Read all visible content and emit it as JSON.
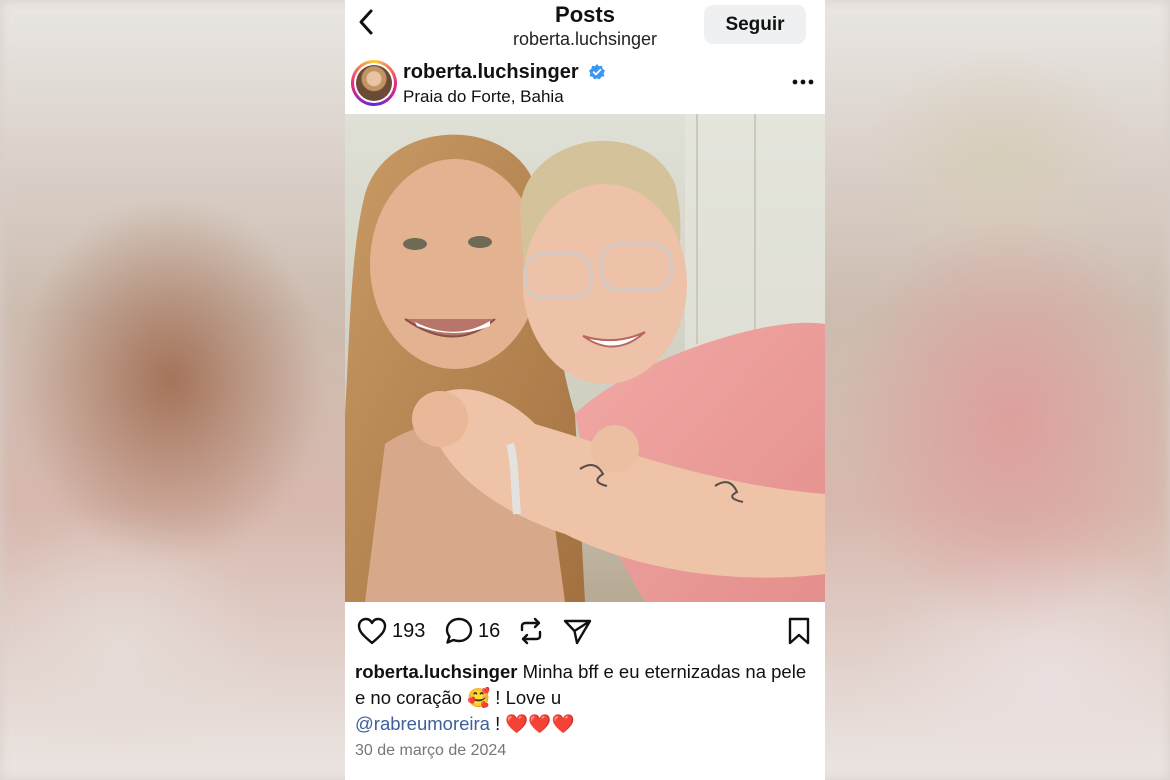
{
  "header": {
    "title": "Posts",
    "subtitle": "roberta.luchsinger",
    "follow_label": "Seguir"
  },
  "post": {
    "username": "roberta.luchsinger",
    "verified": true,
    "location": "Praia do Forte, Bahia",
    "likes": "193",
    "comments": "16",
    "caption_user": "roberta.luchsinger",
    "caption_text": "Minha bff e eu eternizadas na pele e no coração",
    "caption_emoji": "🥰",
    "caption_after": "! Love u",
    "mention": "@rabreumoreira",
    "caption_end": "!",
    "hearts": "❤️❤️❤️",
    "date": "30 de março de 2024"
  },
  "colors": {
    "verified_badge": "#3897f0",
    "mention": "#3e5e9c",
    "follow_button_bg": "#eef0f2",
    "heart": "#e0245e"
  },
  "icons": [
    "back-icon",
    "verified-icon",
    "more-icon",
    "like-icon",
    "comment-icon",
    "repost-icon",
    "share-icon",
    "save-icon"
  ]
}
